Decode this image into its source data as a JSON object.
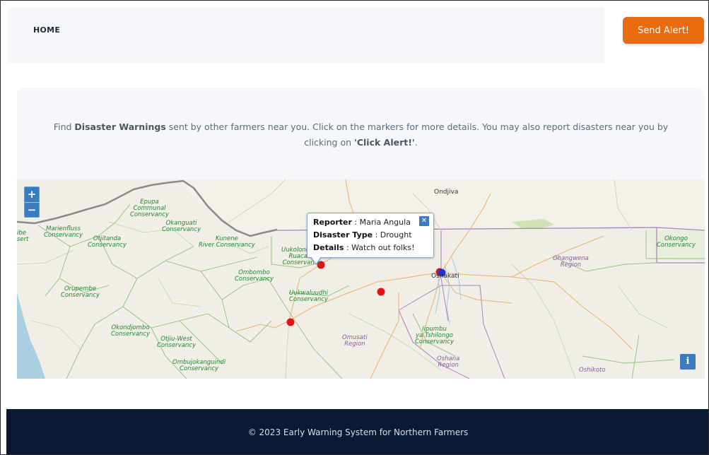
{
  "nav": {
    "home_label": "HOME",
    "alert_button_label": "Send Alert!"
  },
  "intro": {
    "text_1": "Find ",
    "bold_1": "Disaster Warnings",
    "text_2": " sent by other farmers near you. Click on the markers for more details. You may also report disasters near you by clicking on ",
    "bold_2": "'Click Alert!'",
    "text_3": "."
  },
  "map": {
    "zoom_in": "+",
    "zoom_out": "−",
    "info": "i",
    "popup": {
      "reporter_label": "Reporter",
      "reporter_value": " : Maria Angula",
      "type_label": "Disaster Type",
      "type_value": " : Drought",
      "details_label": "Details",
      "details_value": " : Watch out folks!",
      "close": "✕"
    },
    "labels": {
      "epupa": "Epupa\nCommunal\nConservancy",
      "okanguati": "Okanguati\nConservancy",
      "marienfluss": "Marienfluss\nConservancy",
      "otjitanda": "Otjitanda\nConservancy",
      "kunene": "Kunene\nRiver Conservancy",
      "uukolonkadhi": "Uukolonkadhi\nRuacana\nConservancy",
      "ombombo": "Ombombo\nConservancy",
      "orupembe": "Orupembe\nConservancy",
      "uukwaluudhi": "Uukwaluudhi\nConservancy",
      "okondjombo": "Okondjombo\nConservancy",
      "otjiu_west": "Otjiu-West\nConservancy",
      "ombujokanguindi": "Ombujokanguindi\nConservancy",
      "omusati": "Omusati\nRegion",
      "ohangwena": "Ohangwena\nRegion",
      "oshana": "Oshana\nRegion",
      "iipumbu": "Iipumbu\nya Tshilongo\nConservancy",
      "okongo": "Okongo\nConservancy",
      "oshikoto": "Oshikoto",
      "ondjiva": "Ondjiva",
      "oshakati": "Oshakati",
      "left_edge": "ibe\nsert"
    }
  },
  "footer": {
    "text": "© 2023 Early Warning System for Northern Farmers"
  },
  "colors": {
    "accent_button": "#ea6a0e",
    "footer_bg": "#0b1a34",
    "marker_red": "#e11313",
    "marker_blue": "#1d33d6",
    "leaflet_control": "#3b7bbf"
  }
}
